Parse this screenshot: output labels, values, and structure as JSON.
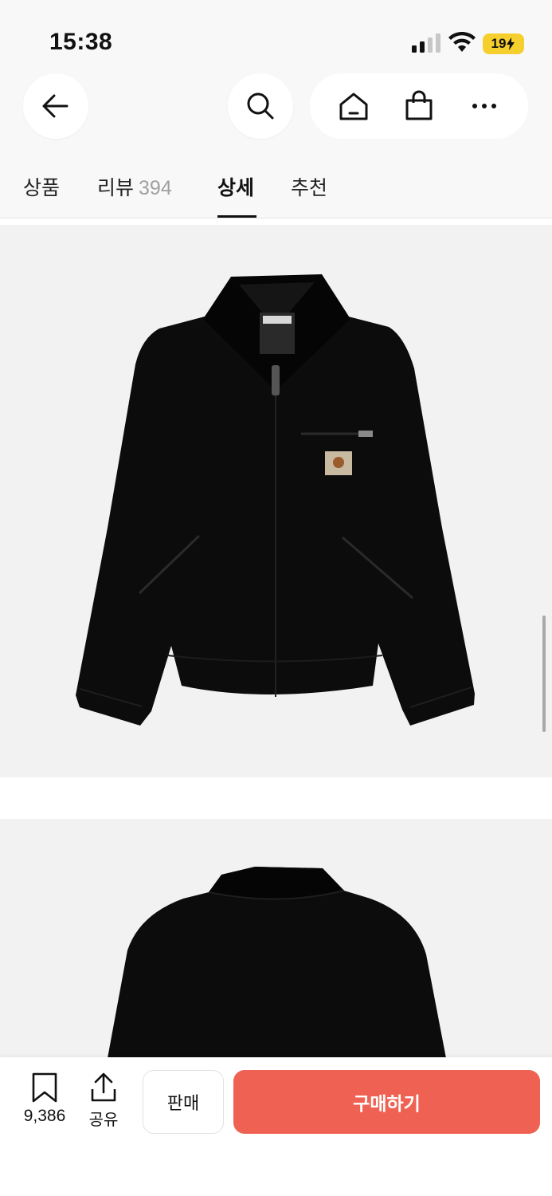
{
  "status_bar": {
    "time": "15:38",
    "battery_level": "19",
    "icons": [
      "cellular-signal-icon",
      "wifi-icon",
      "battery-charging-icon"
    ]
  },
  "nav": {
    "icons": [
      "back-arrow-icon",
      "search-icon",
      "home-icon",
      "shopping-bag-icon",
      "more-dots-icon"
    ]
  },
  "tabs": [
    {
      "label": "상품",
      "count": ""
    },
    {
      "label": "리뷰",
      "count": "394"
    },
    {
      "label": "상세",
      "count": ""
    },
    {
      "label": "추천",
      "count": ""
    }
  ],
  "active_tab": "상세",
  "images": [
    {
      "type": "product-photo",
      "subject": "black zip jacket front view"
    },
    {
      "type": "product-photo",
      "subject": "black zip jacket back view"
    }
  ],
  "bottom_bar": {
    "bookmark_count": "9,386",
    "share_label": "공유",
    "sell_label": "판매",
    "buy_label": "구매하기"
  },
  "colors": {
    "accent": "#ef6253",
    "battery": "#f5cf2e",
    "background": "#f8f8f8",
    "image_bg": "#f2f2f2"
  }
}
